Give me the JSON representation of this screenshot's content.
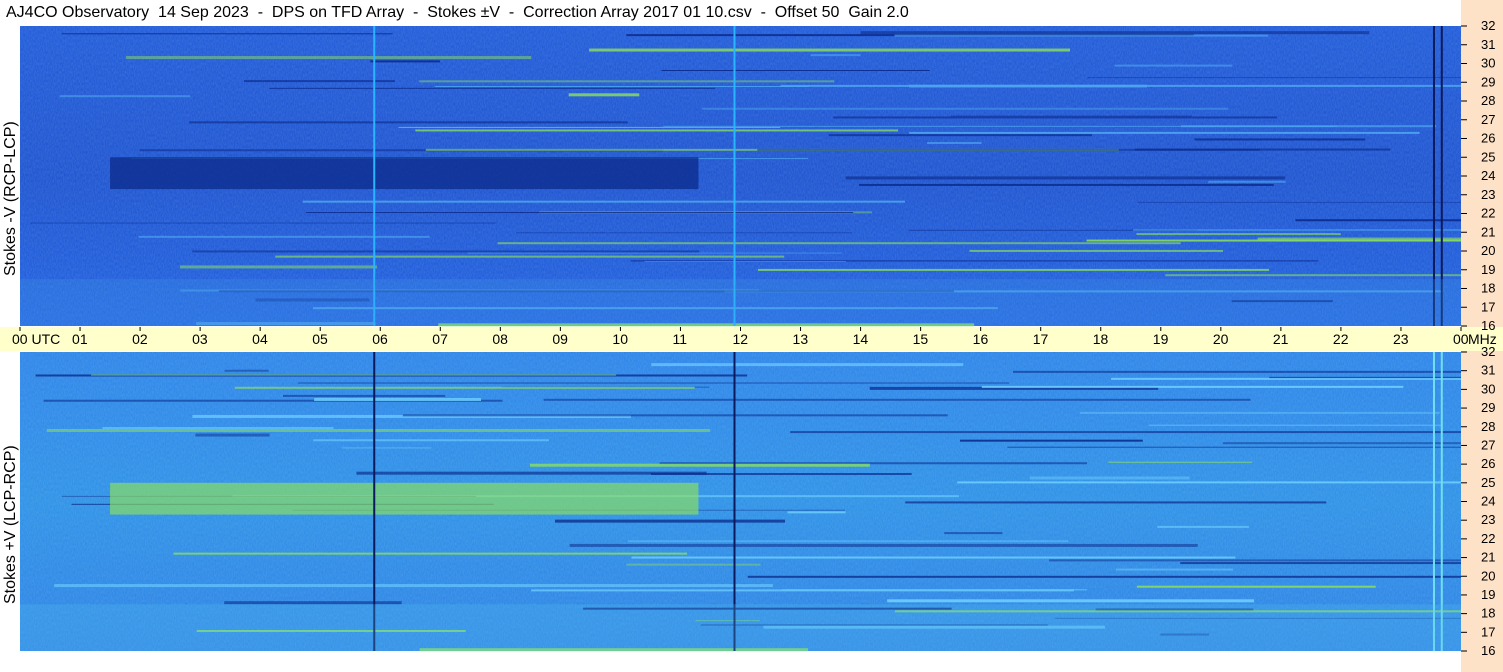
{
  "title": "AJ4CO Observatory  14 Sep 2023  -  DPS on TFD Array  -  Stokes ±V  -  Correction Array 2017 01 10.csv  -  Offset 50  Gain 2.0",
  "colors": {
    "side_strip": "#fde2c8",
    "x_band": "#ffffcc",
    "spec_base": "#1f5fdc",
    "spec_dark": "#0b2a8a",
    "spec_bright": "#27c7e6",
    "spec_green": "#8ee25a"
  },
  "chart_data": [
    {
      "type": "heatmap",
      "name": "top-panel",
      "ylabel": "Stokes -V (RCP-LCP)",
      "y_unit": "MHz",
      "ylim": [
        16,
        32
      ],
      "y_ticks": [
        "32",
        "31",
        "30",
        "29",
        "28",
        "27",
        "26",
        "25",
        "24",
        "23",
        "22",
        "21",
        "20",
        "19",
        "18",
        "17",
        "16"
      ],
      "features": [
        {
          "kind": "dark-block",
          "x": [
            1.5,
            11.3
          ],
          "y": [
            23.3,
            25
          ]
        },
        {
          "kind": "vline",
          "x": 5.9,
          "color": "#29b6ff"
        },
        {
          "kind": "vline",
          "x": 11.9,
          "color": "#29b6ff"
        },
        {
          "kind": "vline",
          "x": 23.55,
          "color": "#0a1a5c"
        },
        {
          "kind": "vline",
          "x": 23.68,
          "color": "#0a1a5c"
        }
      ]
    },
    {
      "type": "heatmap",
      "name": "bottom-panel",
      "ylabel": "Stokes +V (LCP-RCP)",
      "y_unit": "MHz",
      "ylim": [
        16,
        32
      ],
      "y_ticks": [
        "32",
        "31",
        "30",
        "29",
        "28",
        "27",
        "26",
        "25",
        "24",
        "23",
        "22",
        "21",
        "20",
        "19",
        "18",
        "17",
        "16"
      ],
      "features": [
        {
          "kind": "bright-block",
          "x": [
            1.5,
            11.3
          ],
          "y": [
            23.3,
            25
          ]
        },
        {
          "kind": "vline",
          "x": 5.9,
          "color": "#0a1a5c"
        },
        {
          "kind": "vline",
          "x": 11.9,
          "color": "#0a1a5c"
        },
        {
          "kind": "vline",
          "x": 23.55,
          "color": "#6fe0f0"
        },
        {
          "kind": "vline",
          "x": 23.68,
          "color": "#6fe0f0"
        }
      ]
    }
  ],
  "x_axis": {
    "xlim": [
      0,
      24
    ],
    "labels": [
      {
        "hour": 0,
        "text": "00  UTC"
      },
      {
        "hour": 1,
        "text": "01"
      },
      {
        "hour": 2,
        "text": "02"
      },
      {
        "hour": 3,
        "text": "03"
      },
      {
        "hour": 4,
        "text": "04"
      },
      {
        "hour": 5,
        "text": "05"
      },
      {
        "hour": 6,
        "text": "06"
      },
      {
        "hour": 7,
        "text": "07"
      },
      {
        "hour": 8,
        "text": "08"
      },
      {
        "hour": 9,
        "text": "09"
      },
      {
        "hour": 10,
        "text": "10"
      },
      {
        "hour": 11,
        "text": "11"
      },
      {
        "hour": 12,
        "text": "12"
      },
      {
        "hour": 13,
        "text": "13"
      },
      {
        "hour": 14,
        "text": "14"
      },
      {
        "hour": 15,
        "text": "15"
      },
      {
        "hour": 16,
        "text": "16"
      },
      {
        "hour": 17,
        "text": "17"
      },
      {
        "hour": 18,
        "text": "18"
      },
      {
        "hour": 19,
        "text": "19"
      },
      {
        "hour": 20,
        "text": "20"
      },
      {
        "hour": 21,
        "text": "21"
      },
      {
        "hour": 22,
        "text": "22"
      },
      {
        "hour": 23,
        "text": "23"
      },
      {
        "hour": 24,
        "text": "00"
      }
    ],
    "unit": "MHz"
  }
}
